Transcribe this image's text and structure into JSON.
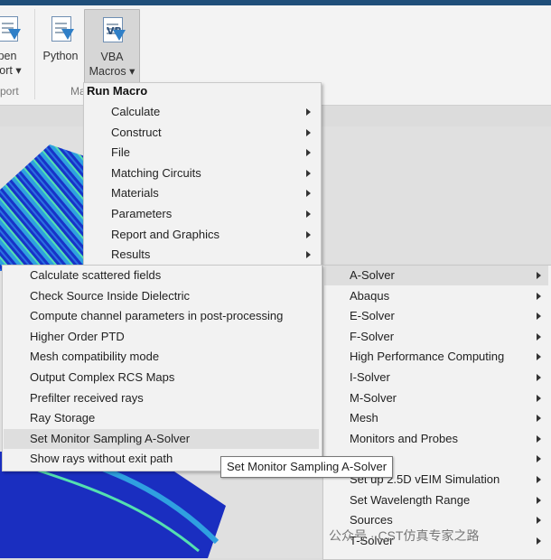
{
  "ribbon": {
    "open_report": {
      "line1": "pen",
      "line2": "port"
    },
    "python": {
      "label": "Python"
    },
    "vba": {
      "line1": "VBA",
      "line2": "Macros"
    },
    "groups": {
      "left": "port",
      "macros": "Ma"
    }
  },
  "run_macro_menu": {
    "title": "Run Macro",
    "items": [
      "Calculate",
      "Construct",
      "File",
      "Matching Circuits",
      "Materials",
      "Parameters",
      "Report and Graphics",
      "Results"
    ]
  },
  "results_submenu": {
    "items": [
      "A-Solver",
      "Abaqus",
      "E-Solver",
      "F-Solver",
      "High Performance Computing",
      "I-Solver",
      "M-Solver",
      "Mesh",
      "Monitors and Probes",
      "",
      "Set up 2.5D vEIM Simulation",
      "Set Wavelength Range",
      "Sources",
      "T-Solver"
    ]
  },
  "asolver_submenu": {
    "items": [
      "Calculate scattered fields",
      "Check Source Inside Dielectric",
      "Compute channel parameters in post-processing",
      "Higher Order PTD",
      "Mesh compatibility mode",
      "Output Complex RCS Maps",
      "Prefilter received rays",
      "Ray Storage",
      "Set Monitor Sampling A-Solver",
      "Show rays without exit path"
    ]
  },
  "tooltip": "Set Monitor Sampling A-Solver",
  "watermark": "公众号 · CST仿真专家之路",
  "colors": {
    "accent": "#1f4e79",
    "menu_bg": "#f2f2f2",
    "highlight": "#dedede"
  }
}
